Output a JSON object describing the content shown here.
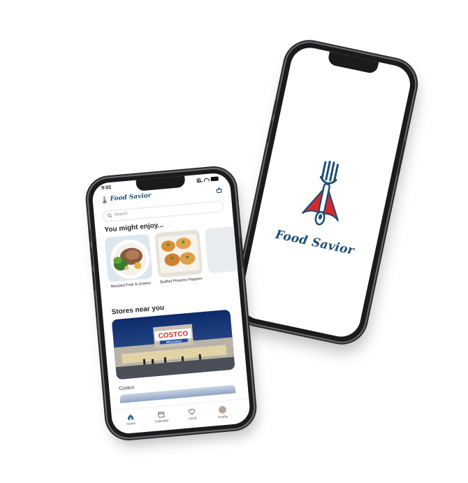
{
  "splash": {
    "brand_name": "Food Savior",
    "logo_icon": "fork-with-cape-logo"
  },
  "app": {
    "status_bar": {
      "time": "9:02"
    },
    "header": {
      "brand_name": "Food Savior",
      "basket_icon": "basket-icon"
    },
    "search": {
      "placeholder": "Search"
    },
    "sections": {
      "recommendations_title": "You might enjoy...",
      "stores_title": "Stores near you"
    },
    "recipes": [
      {
        "name": "Mustard Pork & Greens"
      },
      {
        "name": "Stuffed Pimento Peppers"
      }
    ],
    "stores": [
      {
        "name": "Costco",
        "sign_text": "COSTCO",
        "sign_subtext": "WHOLESALE"
      }
    ],
    "tabs": [
      {
        "label": "Home",
        "icon": "home-icon"
      },
      {
        "label": "Calendar",
        "icon": "calendar-icon"
      },
      {
        "label": "Liked",
        "icon": "heart-icon"
      },
      {
        "label": "Profile",
        "icon": "avatar"
      }
    ]
  },
  "colors": {
    "brand_blue": "#1e4d78",
    "cape_red": "#d62a2a",
    "store_blue": "#0f2a63",
    "tab_active": "#2f6fa8"
  }
}
